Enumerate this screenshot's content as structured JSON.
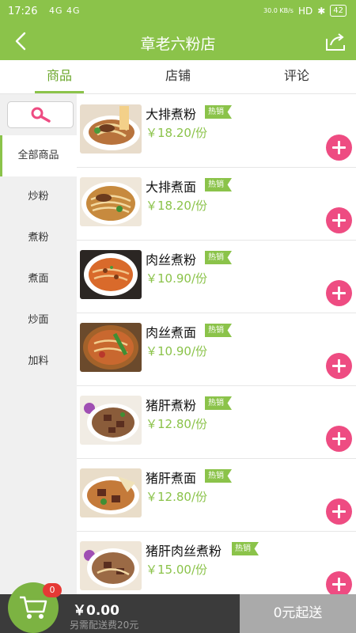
{
  "status_bar": {
    "time": "17:26",
    "signal": "4G 4G",
    "net_speed": "30.0 KB/s",
    "hd": "HD",
    "battery": "42"
  },
  "header": {
    "title": "章老六粉店"
  },
  "tabs": [
    {
      "label": "商品"
    },
    {
      "label": "店铺"
    },
    {
      "label": "评论"
    }
  ],
  "sidebar": {
    "categories": [
      {
        "label": "全部商品"
      },
      {
        "label": "炒粉"
      },
      {
        "label": "煮粉"
      },
      {
        "label": "煮面"
      },
      {
        "label": "炒面"
      },
      {
        "label": "加料"
      }
    ]
  },
  "products": [
    {
      "name": "大排煮粉",
      "tag": "热销",
      "price": "￥18.20/份"
    },
    {
      "name": "大排煮面",
      "tag": "热销",
      "price": "￥18.20/份"
    },
    {
      "name": "肉丝煮粉",
      "tag": "热销",
      "price": "￥10.90/份"
    },
    {
      "name": "肉丝煮面",
      "tag": "热销",
      "price": "￥10.90/份"
    },
    {
      "name": "猪肝煮粉",
      "tag": "热销",
      "price": "￥12.80/份"
    },
    {
      "name": "猪肝煮面",
      "tag": "热销",
      "price": "￥12.80/份"
    },
    {
      "name": "猪肝肉丝煮粉",
      "tag": "热销",
      "price": "￥15.00/份"
    }
  ],
  "cart": {
    "count": "0",
    "total": "￥0.00",
    "delivery_note": "另需配送费20元",
    "checkout_label": "0元起送"
  },
  "colors": {
    "accent": "#8bc34a",
    "add_button": "#ee4c82",
    "bottom_bar": "#3b3b3b",
    "checkout_disabled": "#aaaaaa"
  }
}
